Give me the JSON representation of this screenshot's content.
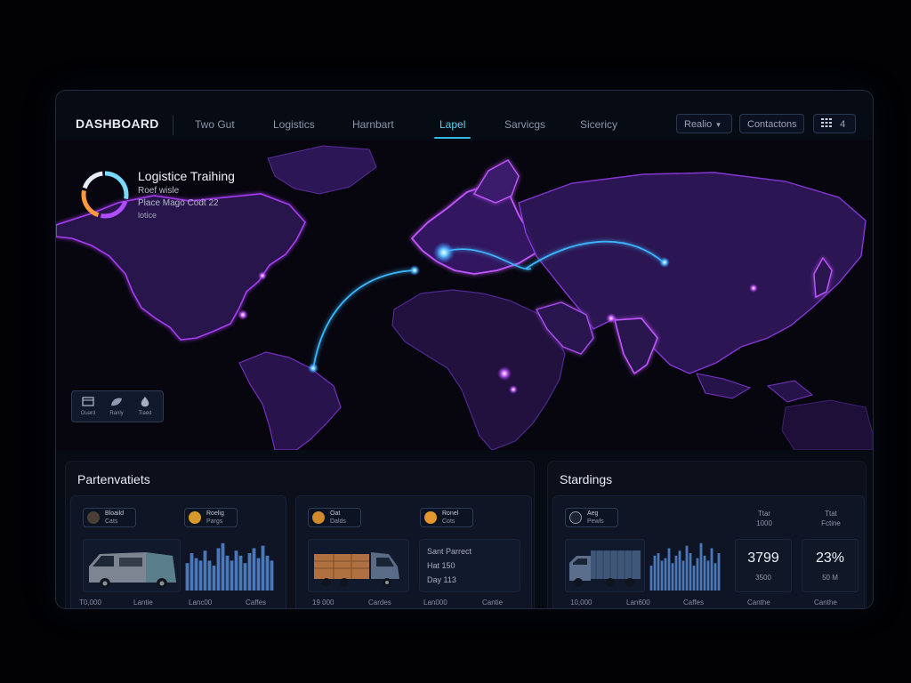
{
  "app": {
    "brand": "DASHBOARD",
    "nav_tabs": [
      "Two Gut",
      "Logistics",
      "Harnbart",
      "Lapel",
      "Sarvicgs",
      "Sicericy"
    ],
    "active_tab": "Lapel",
    "buttons": {
      "filter_label": "Realio",
      "contact_label": "Contactons",
      "view_label": "4"
    },
    "accent_color": "#33b8e6",
    "map_glow_color": "#8a2be2"
  },
  "tracking": {
    "title": "Logistice Traihing",
    "line1": "Roef wisle",
    "line2": "Place Mago Codt 22",
    "line3": "lotice",
    "ring_segments": [
      0.3,
      0.25,
      0.25,
      0.2
    ],
    "ring_colors": [
      "#7ad9ff",
      "#b24cff",
      "#ff9a3c",
      "#e7e9f5"
    ]
  },
  "map_tools": [
    {
      "icon": "package-icon",
      "label": "Ouard"
    },
    {
      "icon": "leaf-icon",
      "label": "Ranly"
    },
    {
      "icon": "drop-icon",
      "label": "Tlaed"
    }
  ],
  "panels": {
    "left_title": "Partenvatiets",
    "right_title": "Stardings"
  },
  "cards": {
    "card1": {
      "chip1": {
        "icon": "worker-icon",
        "l1": "Bloaild",
        "l2": "Cats"
      },
      "chip2": {
        "icon": "coin-icon",
        "l1": "Roelig",
        "l2": "Pargs"
      },
      "foot": [
        "T0,000",
        "Lantie",
        "Lanc00",
        "Caffes"
      ],
      "bars": [
        0.55,
        0.75,
        0.65,
        0.6,
        0.8,
        0.6,
        0.5,
        0.85,
        0.95,
        0.7,
        0.6,
        0.8,
        0.7,
        0.55,
        0.75,
        0.85,
        0.65,
        0.9,
        0.7,
        0.6
      ]
    },
    "card2": {
      "chip1": {
        "icon": "box-icon",
        "l1": "Oat",
        "l2": "Dalds"
      },
      "chip2": {
        "icon": "bolt-icon",
        "l1": "Ronel",
        "l2": "Cots"
      },
      "info": [
        "Sant Parrect",
        "Hat 150",
        "Day 113"
      ],
      "foot": [
        "19 000",
        "Cardes",
        "Lan000",
        "Cantie"
      ]
    },
    "card3": {
      "chip1": {
        "icon": "globe-icon",
        "l1": "Aeg",
        "l2": "Pewls"
      },
      "foot": [
        "10,000",
        "Lan600",
        "Caffes"
      ],
      "bars": [
        0.5,
        0.7,
        0.75,
        0.6,
        0.65,
        0.85,
        0.55,
        0.7,
        0.8,
        0.6,
        0.9,
        0.75,
        0.5,
        0.65,
        0.95,
        0.7,
        0.6,
        0.85,
        0.55,
        0.75
      ]
    },
    "stats": [
      {
        "header": "Ttar\n1000",
        "value": "3799",
        "sub": "3500",
        "foot": "Canthe"
      },
      {
        "header": "Ttat\nFctine",
        "value": "23%",
        "sub": "50 M",
        "foot": "Canthe"
      }
    ]
  }
}
